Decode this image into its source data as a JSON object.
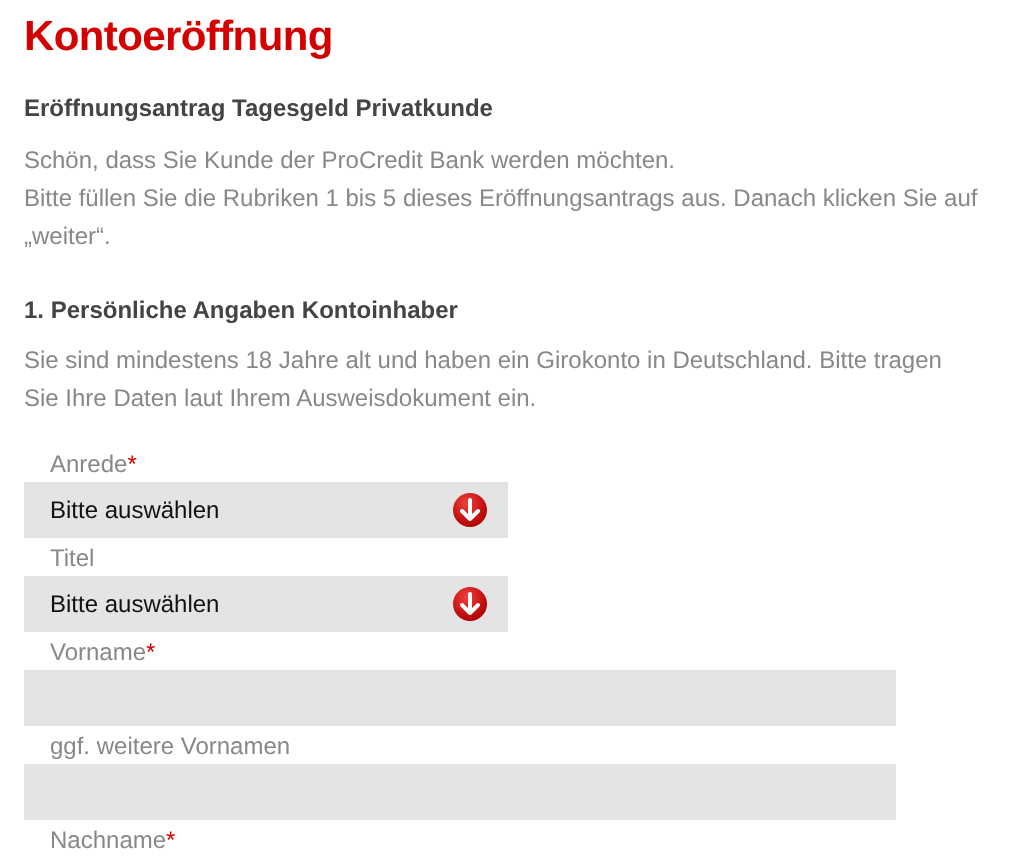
{
  "title": "Kontoeröffnung",
  "subtitle": "Eröffnungsantrag Tagesgeld Privatkunde",
  "intro": [
    "Schön, dass Sie Kunde der ProCredit Bank werden möchten.",
    "Bitte füllen Sie die Rubriken 1 bis 5 dieses Eröffnungsantrags aus. Danach klicken Sie auf „weiter“."
  ],
  "section": {
    "heading": "1. Persönliche Angaben Kontoinhaber",
    "text": "Sie sind mindestens 18 Jahre alt und haben ein Girokonto in Deutschland. Bitte tragen Sie Ihre Daten laut Ihrem Ausweisdokument ein."
  },
  "fields": [
    {
      "kind": "select",
      "label": "Anrede",
      "required_mark": "*",
      "value": "Bitte auswählen"
    },
    {
      "kind": "select",
      "label": "Titel",
      "value": "Bitte auswählen"
    },
    {
      "kind": "text",
      "label": "Vorname",
      "required_mark": "*"
    },
    {
      "kind": "text",
      "label": "ggf. weitere Vornamen"
    },
    {
      "kind": "label",
      "label": "Nachname",
      "required_mark": "*"
    }
  ]
}
